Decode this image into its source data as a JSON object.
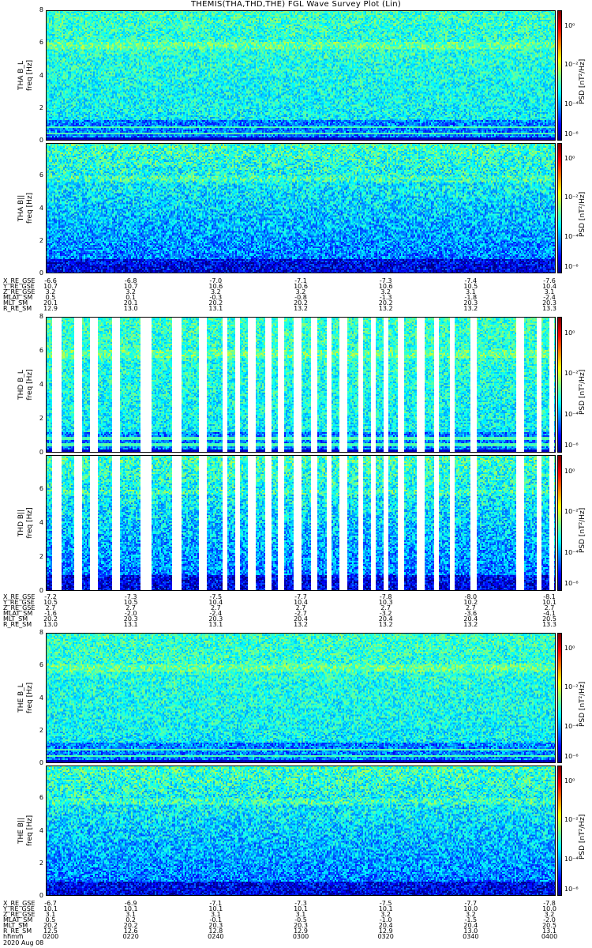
{
  "title": "THEMIS(THA,THD,THE) FGL Wave Survey Plot (Lin)",
  "colors": {
    "background": "#ffffff",
    "axis": "#000000"
  },
  "chart_data": [
    {
      "type": "heatmap",
      "probe": "THA",
      "ylabel_line1": "THA B_L",
      "ylabel_line2": "freq [Hz]",
      "yticks": [
        "0",
        "2",
        "4",
        "6",
        "8"
      ],
      "ylim": [
        0,
        8
      ],
      "zlabel": "PSD [nT²/Hz]",
      "zticks": [
        "10⁰",
        "10⁻²",
        "10⁻⁴",
        "10⁻⁶"
      ],
      "gaps": false
    },
    {
      "type": "heatmap",
      "probe": "THA",
      "ylabel_line1": "THA B||",
      "ylabel_line2": "freq [Hz]",
      "yticks": [
        "0",
        "2",
        "4",
        "6"
      ],
      "ylim": [
        0,
        8
      ],
      "zlabel": "PSD [nT²/Hz]",
      "zticks": [
        "10⁰",
        "10⁻²",
        "10⁻⁴",
        "10⁻⁶"
      ],
      "gaps": false
    },
    {
      "type": "heatmap",
      "probe": "THD",
      "ylabel_line1": "THD B_L",
      "ylabel_line2": "freq [Hz]",
      "yticks": [
        "0",
        "2",
        "4",
        "6",
        "8"
      ],
      "ylim": [
        0,
        8
      ],
      "zlabel": "PSD [nT²/Hz]",
      "zticks": [
        "10⁰",
        "10⁻²",
        "10⁻⁴",
        "10⁻⁶"
      ],
      "gaps": true
    },
    {
      "type": "heatmap",
      "probe": "THD",
      "ylabel_line1": "THD B||",
      "ylabel_line2": "freq [Hz]",
      "yticks": [
        "0",
        "2",
        "4",
        "6"
      ],
      "ylim": [
        0,
        8
      ],
      "zlabel": "PSD [nT²/Hz]",
      "zticks": [
        "10⁰",
        "10⁻²",
        "10⁻⁴",
        "10⁻⁶"
      ],
      "gaps": true
    },
    {
      "type": "heatmap",
      "probe": "THE",
      "ylabel_line1": "THE B_L",
      "ylabel_line2": "freq [Hz]",
      "yticks": [
        "0",
        "2",
        "4",
        "6",
        "8"
      ],
      "ylim": [
        0,
        8
      ],
      "zlabel": "PSD [nT²/Hz]",
      "zticks": [
        "10⁰",
        "10⁻²",
        "10⁻⁴",
        "10⁻⁶"
      ],
      "gaps": false
    },
    {
      "type": "heatmap",
      "probe": "THE",
      "ylabel_line1": "THE B||",
      "ylabel_line2": "freq [Hz]",
      "yticks": [
        "0",
        "2",
        "4",
        "6"
      ],
      "ylim": [
        0,
        8
      ],
      "zlabel": "PSD [nT²/Hz]",
      "zticks": [
        "10⁰",
        "10⁻²",
        "10⁻⁴",
        "10⁻⁶"
      ],
      "gaps": false
    }
  ],
  "ephemeris": [
    {
      "probe": "THA",
      "labels": [
        "X_RE_GSE",
        "Y_RE_GSE",
        "Z_RE_GSE",
        "MLAT_SM",
        "MLT_SM",
        "R_RE_SM"
      ],
      "rows": [
        [
          "-6.6",
          "-6.8",
          "-7.0",
          "-7.1",
          "-7.3",
          "-7.4",
          "-7.6"
        ],
        [
          "10.7",
          "10.7",
          "10.6",
          "10.6",
          "10.6",
          "10.5",
          "10.4"
        ],
        [
          "3.2",
          "3.2",
          "3.2",
          "3.2",
          "3.2",
          "3.1",
          "3.1"
        ],
        [
          "0.5",
          "0.1",
          "-0.3",
          "-0.8",
          "-1.3",
          "-1.8",
          "-2.4"
        ],
        [
          "20.1",
          "20.1",
          "20.2",
          "20.2",
          "20.2",
          "20.3",
          "20.3"
        ],
        [
          "12.9",
          "13.0",
          "13.1",
          "13.2",
          "13.2",
          "13.2",
          "13.3"
        ]
      ]
    },
    {
      "probe": "THD",
      "labels": [
        "X_RE_GSE",
        "Y_RE_GSE",
        "Z_RE_GSE",
        "MLAT_SM",
        "MLT_SM",
        "R_RE_SM"
      ],
      "rows": [
        [
          "-7.2",
          "-7.3",
          "-7.5",
          "-7.7",
          "-7.8",
          "-8.0",
          "-8.1"
        ],
        [
          "10.5",
          "10.5",
          "10.4",
          "10.4",
          "10.3",
          "10.2",
          "10.1"
        ],
        [
          "2.7",
          "2.7",
          "2.7",
          "2.7",
          "2.7",
          "2.7",
          "2.7"
        ],
        [
          "-1.6",
          "-2.0",
          "-2.4",
          "-2.7",
          "-3.2",
          "-3.6",
          "-4.1"
        ],
        [
          "20.2",
          "20.3",
          "20.3",
          "20.4",
          "20.4",
          "20.4",
          "20.5"
        ],
        [
          "13.0",
          "13.1",
          "13.1",
          "13.2",
          "13.2",
          "13.2",
          "13.3"
        ]
      ]
    },
    {
      "probe": "THE",
      "labels": [
        "X_RE_GSE",
        "Y_RE_GSE",
        "Z_RE_GSE",
        "MLAT_SM",
        "MLT_SM",
        "R_RE_SM"
      ],
      "rows": [
        [
          "-6.7",
          "-6.9",
          "-7.1",
          "-7.3",
          "-7.5",
          "-7.7",
          "-7.8"
        ],
        [
          "10.1",
          "10.1",
          "10.1",
          "10.1",
          "10.1",
          "10.0",
          "10.0"
        ],
        [
          "3.1",
          "3.1",
          "3.1",
          "3.1",
          "3.2",
          "3.2",
          "3.2"
        ],
        [
          "0.5",
          "0.2",
          "-0.1",
          "-0.5",
          "-1.0",
          "-1.5",
          "-2.0"
        ],
        [
          "20.2",
          "20.2",
          "20.3",
          "20.3",
          "20.4",
          "20.4",
          "20.5"
        ],
        [
          "12.5",
          "12.6",
          "12.8",
          "12.9",
          "12.9",
          "13.0",
          "13.1"
        ]
      ]
    }
  ],
  "time_axis": {
    "label": "hhmm",
    "ticks": [
      "0200",
      "0220",
      "0240",
      "0300",
      "0320",
      "0340",
      "0400"
    ]
  },
  "date": "2020 Aug 08"
}
